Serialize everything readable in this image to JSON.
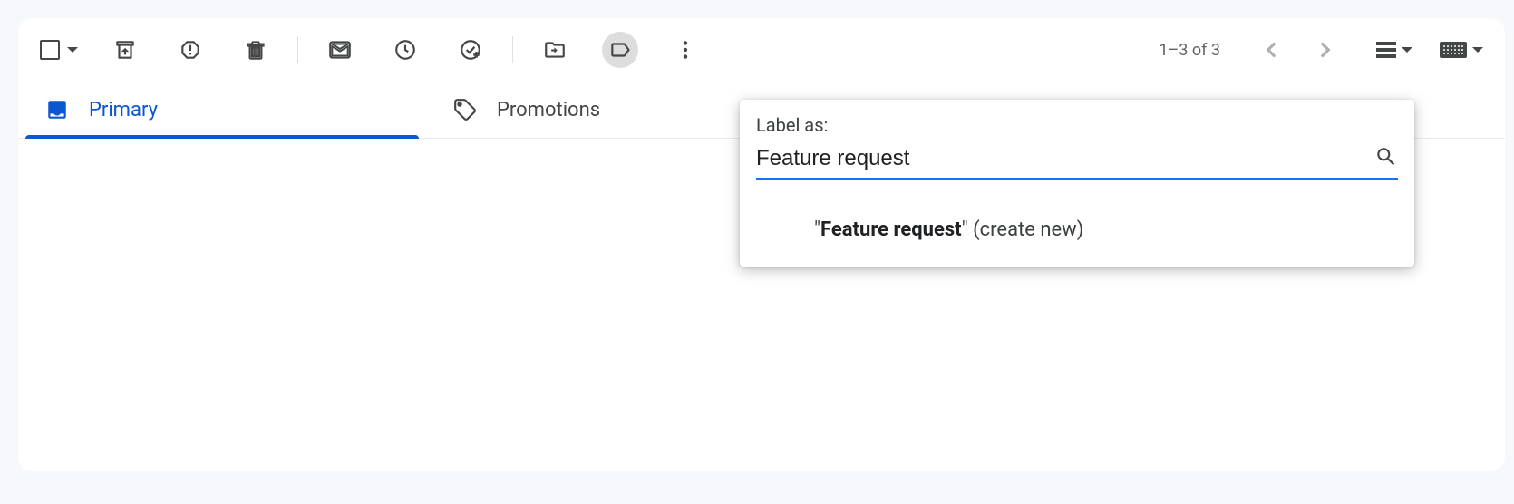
{
  "toolbar": {
    "page_info": "1–3 of 3"
  },
  "tabs": {
    "primary": "Primary",
    "promotions": "Promotions"
  },
  "label_popup": {
    "title": "Label as:",
    "search_value": "Feature request",
    "create_prefix": "\"",
    "create_bold": "Feature request",
    "create_suffix": "\" (create new)"
  }
}
